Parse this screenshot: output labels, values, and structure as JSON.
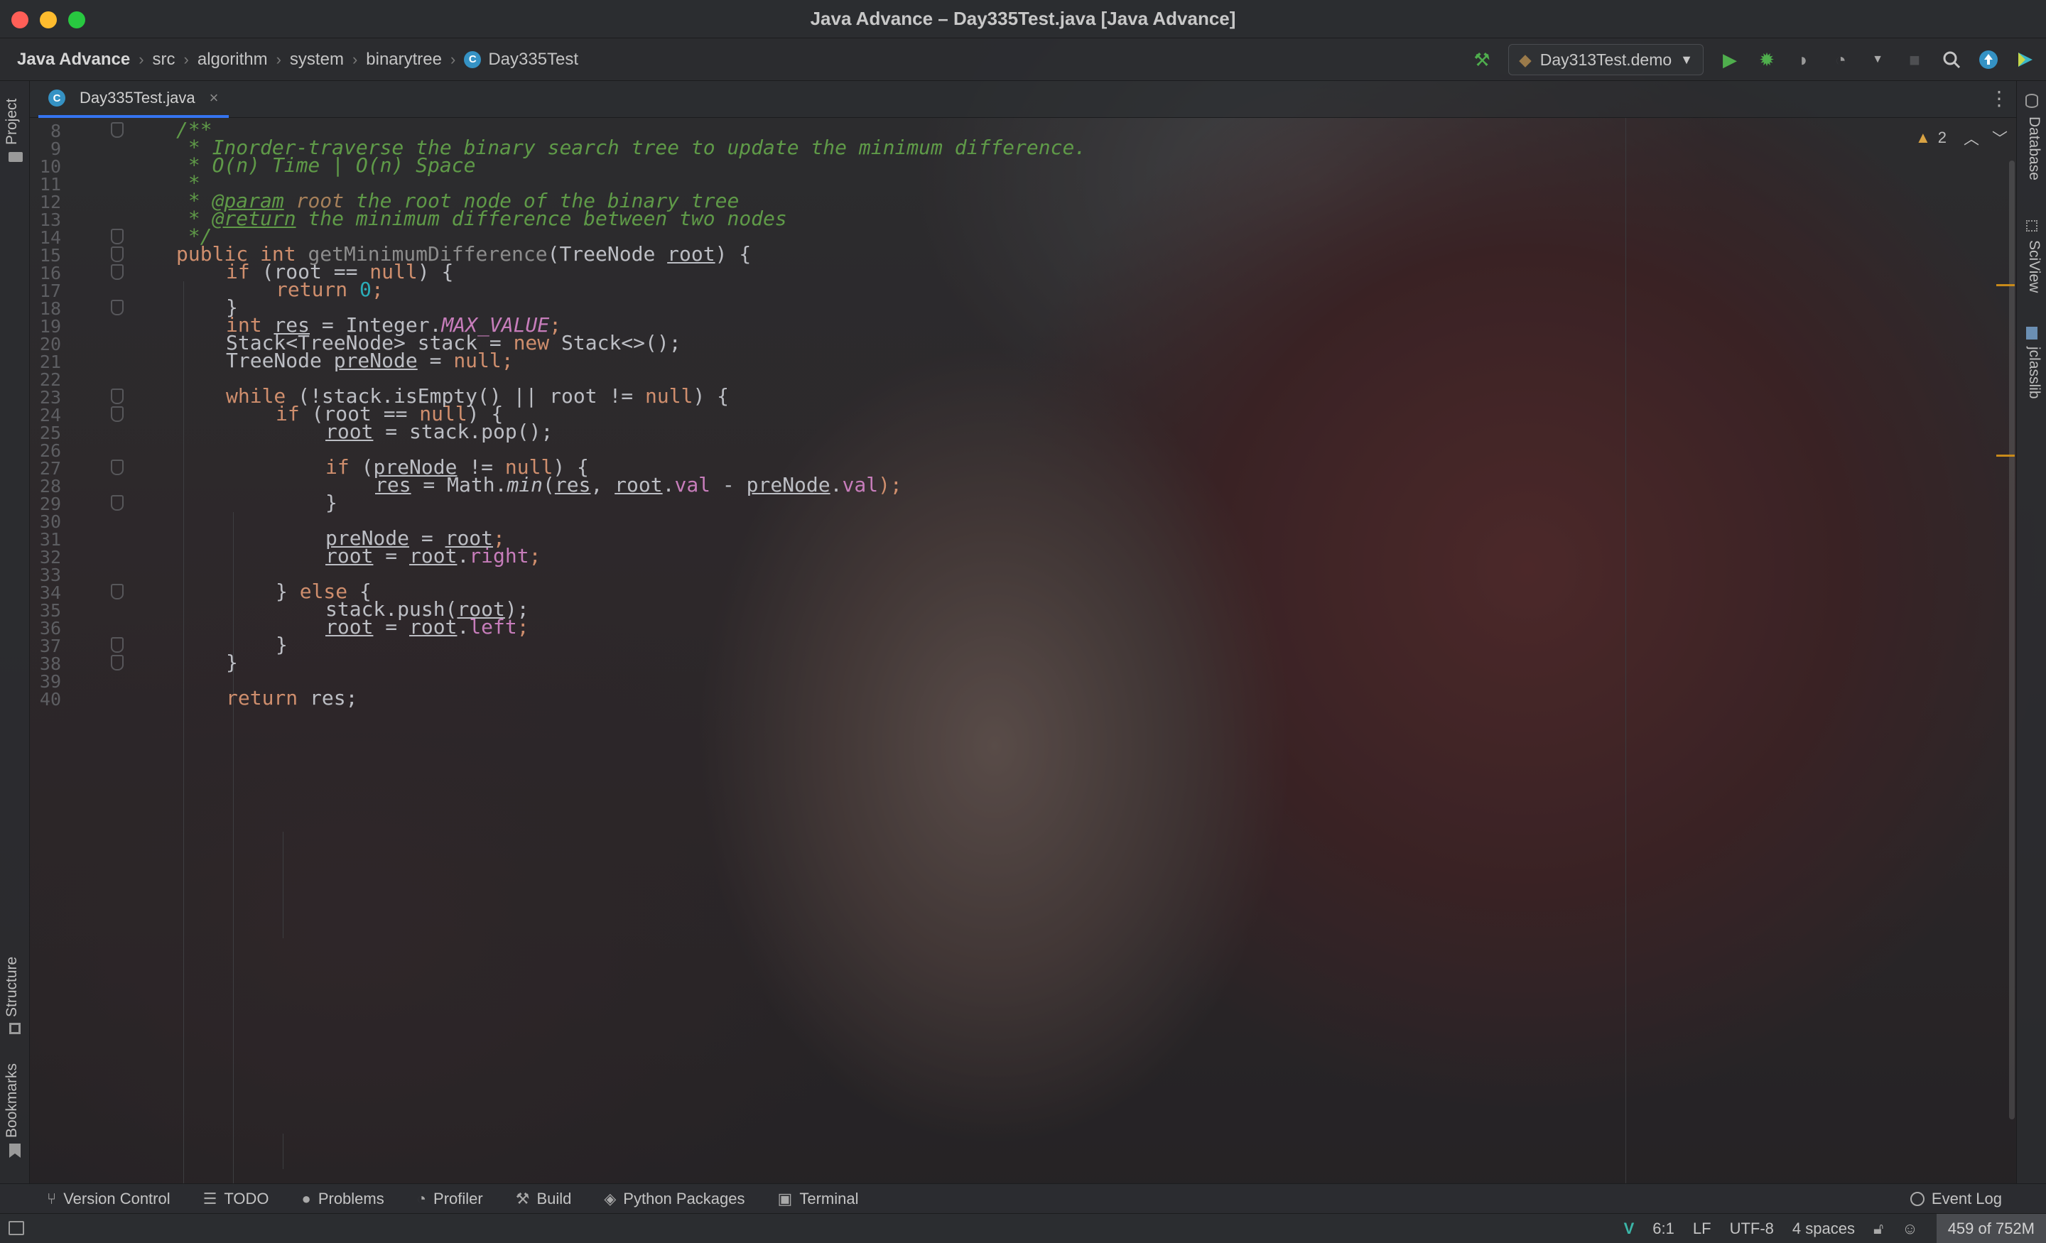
{
  "window": {
    "title": "Java Advance – Day335Test.java [Java Advance]"
  },
  "navbar": {
    "breadcrumbs": [
      "Java Advance",
      "src",
      "algorithm",
      "system",
      "binarytree",
      "Day335Test"
    ],
    "class_badge": "C",
    "run_config": "Day313Test.demo"
  },
  "left_strip": {
    "project_label": "Project",
    "structure_label": "Structure",
    "bookmarks_label": "Bookmarks"
  },
  "right_strip": {
    "database_label": "Database",
    "sciview_label": "SciView",
    "jclasslib_label": "jclasslib"
  },
  "tabs": {
    "active_file": "Day335Test.java",
    "badge": "C",
    "close_glyph": "×"
  },
  "editor": {
    "warning_count": "2",
    "line_numbers": [
      "8",
      "9",
      "10",
      "11",
      "12",
      "13",
      "14",
      "15",
      "16",
      "17",
      "18",
      "19",
      "20",
      "21",
      "22",
      "23",
      "24",
      "25",
      "26",
      "27",
      "28",
      "29",
      "30",
      "31",
      "32",
      "33",
      "34",
      "35",
      "36",
      "37",
      "38",
      "39",
      "40"
    ],
    "code": {
      "l8": "/**",
      "l9": " * Inorder-traverse the binary search tree to update the minimum difference.",
      "l10": " * O(n) Time | O(n) Space",
      "l11": " *",
      "l12_a": " * ",
      "l12_tag": "@param",
      "l12_b": " ",
      "l12_prm": "root",
      "l12_c": " the root node of the binary tree",
      "l13_a": " * ",
      "l13_tag": "@return",
      "l13_b": " the minimum difference between two nodes",
      "l14": " */",
      "l15_kw": "public int ",
      "l15_fn": "getMinimumDifference",
      "l15_a": "(TreeNode ",
      "l15_var": "root",
      "l15_b": ") {",
      "l16_kw": "if",
      "l16_a": " (root == ",
      "l16_null": "null",
      "l16_b": ") {",
      "l17_kw": "return ",
      "l17_num": "0",
      "l17_b": ";",
      "l18": "}",
      "l19_kw": "int ",
      "l19_var": "res",
      "l19_a": " = Integer.",
      "l19_sf": "MAX_VALUE",
      "l19_b": ";",
      "l20_a": "Stack<TreeNode> stack = ",
      "l20_kw": "new",
      "l20_b": " Stack<>();",
      "l21_a": "TreeNode ",
      "l21_var": "preNode",
      "l21_b": " = ",
      "l21_null": "null",
      "l21_c": ";",
      "l23_kw": "while",
      "l23_a": " (!stack.isEmpty() || root != ",
      "l23_null": "null",
      "l23_b": ") {",
      "l24_kw": "if",
      "l24_a": " (root == ",
      "l24_null": "null",
      "l24_b": ") {",
      "l25_var": "root",
      "l25_a": " = stack.pop();",
      "l27_kw": "if",
      "l27_a": " (",
      "l27_var": "preNode",
      "l27_b": " != ",
      "l27_null": "null",
      "l27_c": ") {",
      "l28_var1": "res",
      "l28_a": " = Math.",
      "l28_m": "min",
      "l28_b": "(",
      "l28_var2": "res",
      "l28_c": ", ",
      "l28_var3": "root",
      "l28_d": ".",
      "l28_f1": "val",
      "l28_e": " - ",
      "l28_var4": "preNode",
      "l28_g": ".",
      "l28_f2": "val",
      "l28_h": ");",
      "l29": "}",
      "l31_var1": "preNode",
      "l31_a": " = ",
      "l31_var2": "root",
      "l31_b": ";",
      "l32_var1": "root",
      "l32_a": " = ",
      "l32_var2": "root",
      "l32_b": ".",
      "l32_f": "right",
      "l32_c": ";",
      "l34_a": "} ",
      "l34_kw": "else",
      "l34_b": " {",
      "l35_a": "stack.push(",
      "l35_var": "root",
      "l35_b": ");",
      "l36_var1": "root",
      "l36_a": " = ",
      "l36_var2": "root",
      "l36_b": ".",
      "l36_f": "left",
      "l36_c": ";",
      "l37": "}",
      "l38": "}",
      "l40_kw": "return",
      "l40_a": " res;"
    }
  },
  "tool_windows": [
    {
      "label": "Version Control",
      "icon": "branch-icon"
    },
    {
      "label": "TODO",
      "icon": "list-icon"
    },
    {
      "label": "Problems",
      "icon": "info-icon"
    },
    {
      "label": "Profiler",
      "icon": "profiler-icon"
    },
    {
      "label": "Build",
      "icon": "hammer-icon"
    },
    {
      "label": "Python Packages",
      "icon": "layers-icon"
    },
    {
      "label": "Terminal",
      "icon": "terminal-icon"
    }
  ],
  "event_log": "Event Log",
  "status": {
    "position": "6:1",
    "line_sep": "LF",
    "encoding": "UTF-8",
    "indent": "4 spaces",
    "memory": "459 of 752M"
  },
  "colors": {
    "keyword": "#cf8e6d",
    "comment": "#5f9a48",
    "number": "#2aacb8",
    "field": "#c77dbb",
    "accent": "#3574f0",
    "run_green": "#4fae4d",
    "warning": "#c88a1a"
  }
}
